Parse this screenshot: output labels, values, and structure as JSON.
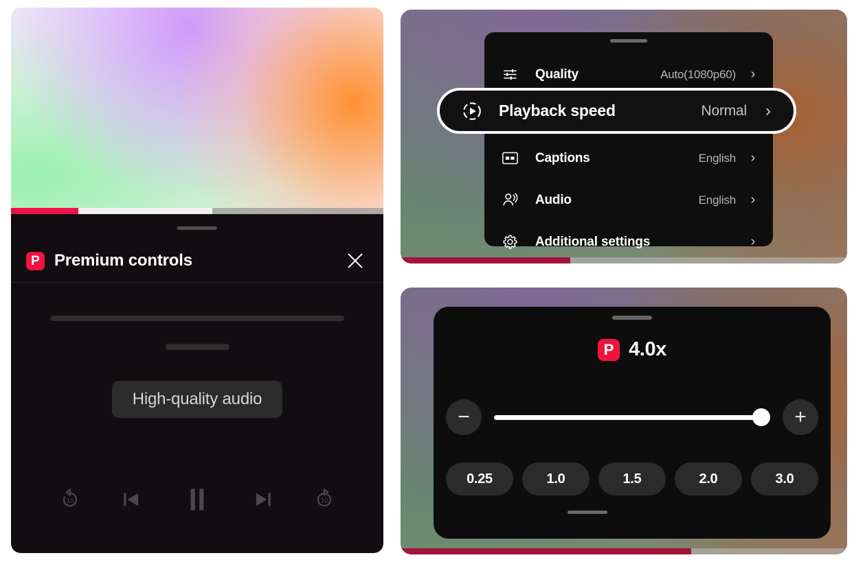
{
  "left_panel": {
    "video": {
      "name": "video-preview"
    },
    "seek": {
      "played_pct": 18,
      "buffered_pct": 36,
      "played_color": "#f0104a",
      "buffered_color": "#f2f2f2",
      "rest_color": "#9a9a9a"
    },
    "header": {
      "badge": "P",
      "title": "Premium controls",
      "close_icon": "close-icon",
      "badge_color": "#f0123f"
    },
    "chip": {
      "label": "High-quality audio"
    },
    "transport": {
      "items": [
        {
          "icon": "replay-10-icon",
          "label": "10"
        },
        {
          "icon": "previous-track-icon",
          "label": ""
        },
        {
          "icon": "pause-icon",
          "label": ""
        },
        {
          "icon": "next-track-icon",
          "label": ""
        },
        {
          "icon": "forward-10-icon",
          "label": "10"
        }
      ]
    }
  },
  "settings_panel": {
    "rows": [
      {
        "icon": "tune-icon",
        "label": "Quality",
        "value": "Auto(1080p60)",
        "chevron": "›"
      },
      {
        "icon": "playback-speed-icon",
        "label": "Playback speed",
        "value": "Normal",
        "chevron": "›"
      },
      {
        "icon": "closed-captions-icon",
        "label": "Captions",
        "value": "English",
        "chevron": "›"
      },
      {
        "icon": "audio-person-icon",
        "label": "Audio",
        "value": "English",
        "chevron": "›"
      },
      {
        "icon": "gear-icon",
        "label": "Additional settings",
        "value": "",
        "chevron": "›"
      }
    ],
    "highlighted_row_index": 1,
    "seek": {
      "played_pct": 38,
      "played_color": "#a3133a"
    }
  },
  "speed_panel": {
    "badge": "P",
    "badge_color": "#f0123f",
    "current_speed": "4.0x",
    "decrease_label": "−",
    "increase_label": "+",
    "slider": {
      "value_pct": 100,
      "min": 0.25,
      "max": 4.0
    },
    "presets": [
      {
        "label": "0.25"
      },
      {
        "label": "1.0"
      },
      {
        "label": "1.5"
      },
      {
        "label": "2.0"
      },
      {
        "label": "3.0"
      }
    ],
    "seek": {
      "played_pct": 65,
      "played_color": "#a3133a"
    }
  }
}
